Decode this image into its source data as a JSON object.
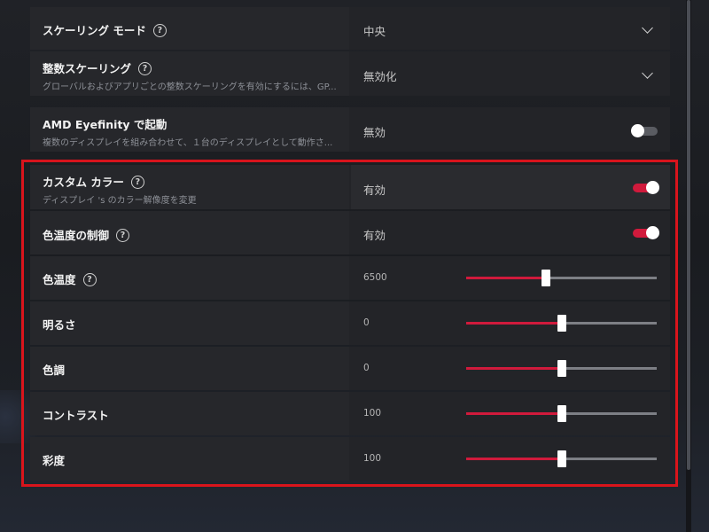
{
  "accent_color": "#d01a3c",
  "highlight_border_color": "#d8141c",
  "rows": {
    "scaling_mode": {
      "label": "スケーリング モード",
      "value": "中央"
    },
    "integer_scaling": {
      "label": "整数スケーリング",
      "description": "グローバルおよびアプリごとの整数スケーリングを有効にするには、GP...",
      "value": "無効化"
    },
    "eyefinity": {
      "label": "AMD Eyefinity で起動",
      "description": "複数のディスプレイを組み合わせて、１台のディスプレイとして動作さ...",
      "value": "無効",
      "enabled": false
    },
    "custom_color": {
      "label": "カスタム カラー",
      "description": "ディスプレイ 's のカラー解像度を変更",
      "value": "有効",
      "enabled": true
    },
    "color_temp_control": {
      "label": "色温度の制御",
      "value": "有効",
      "enabled": true
    },
    "color_temperature": {
      "label": "色温度",
      "value": "6500",
      "slider_fraction": 0.42
    },
    "brightness": {
      "label": "明るさ",
      "value": "0",
      "slider_fraction": 0.5
    },
    "hue": {
      "label": "色調",
      "value": "0",
      "slider_fraction": 0.5
    },
    "contrast": {
      "label": "コントラスト",
      "value": "100",
      "slider_fraction": 0.5
    },
    "saturation": {
      "label": "彩度",
      "value": "100",
      "slider_fraction": 0.5
    }
  },
  "icons": {
    "help": "help-circle-icon",
    "help_glyph": "?",
    "dropdown": "chevron-down-icon"
  }
}
